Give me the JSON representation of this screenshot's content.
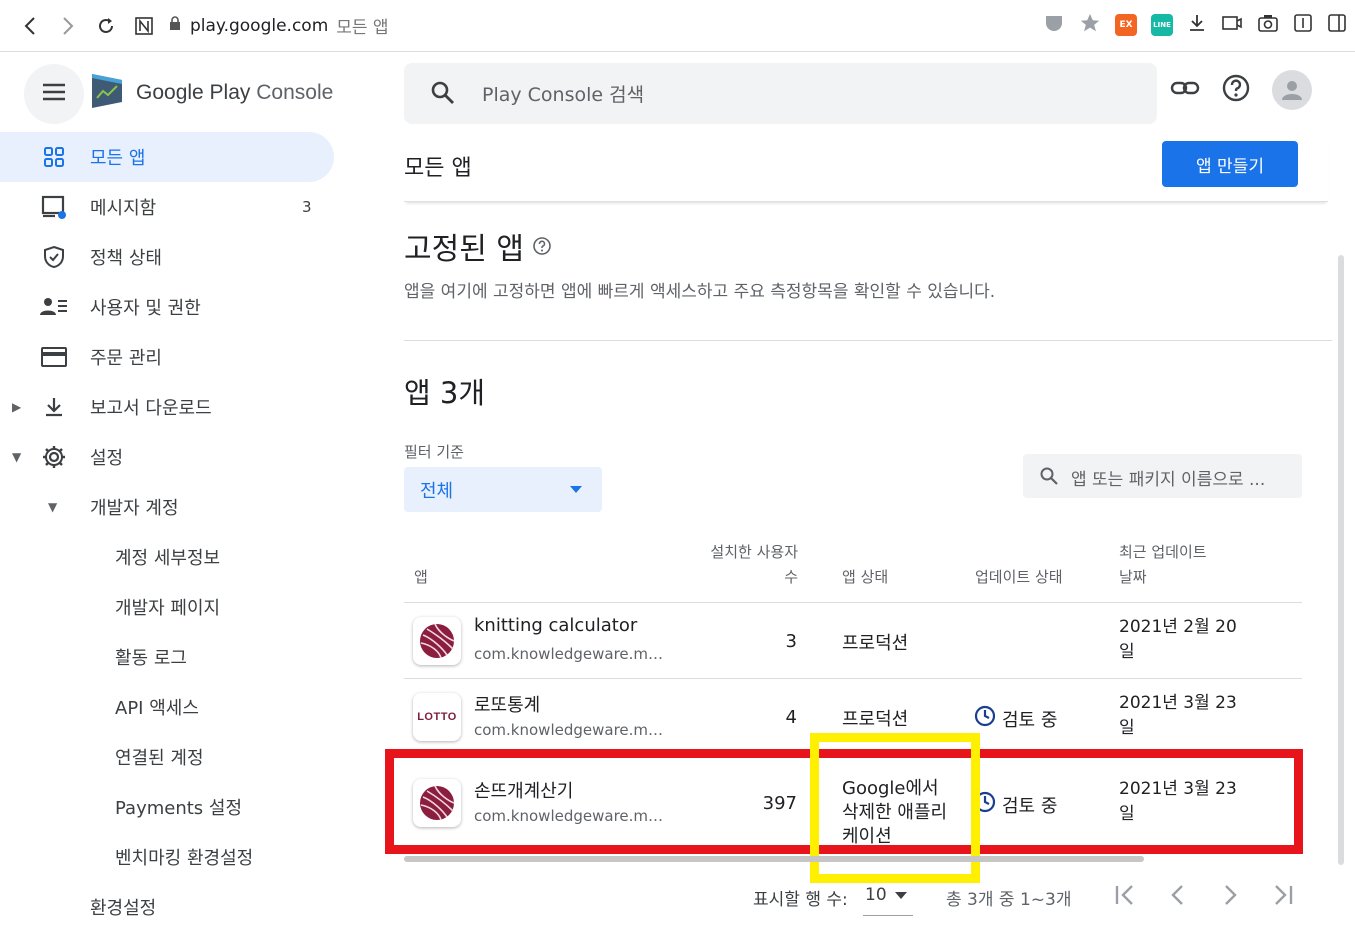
{
  "browser": {
    "host": "play.google.com",
    "path": "모든 앱",
    "ext1": "EX",
    "ext2": "LINE"
  },
  "console": {
    "logo_brand": "Google Play",
    "logo_product": "Console",
    "search_placeholder": "Play Console 검색"
  },
  "sidebar": {
    "items": [
      {
        "label": "모든 앱",
        "icon": "grid-icon"
      },
      {
        "label": "메시지함",
        "badge": "3",
        "icon": "inbox-icon"
      },
      {
        "label": "정책 상태",
        "icon": "shield-icon"
      },
      {
        "label": "사용자 및 권한",
        "icon": "users-icon"
      },
      {
        "label": "주문 관리",
        "icon": "card-icon"
      },
      {
        "label": "보고서 다운로드",
        "icon": "download-icon"
      },
      {
        "label": "설정",
        "icon": "gear-icon"
      },
      {
        "label": "개발자 계정"
      },
      {
        "label": "계정 세부정보"
      },
      {
        "label": "개발자 페이지"
      },
      {
        "label": "활동 로그"
      },
      {
        "label": "API 액세스"
      },
      {
        "label": "연결된 계정"
      },
      {
        "label": "Payments 설정"
      },
      {
        "label": "벤치마킹 환경설정"
      },
      {
        "label": "환경설정"
      }
    ]
  },
  "main": {
    "page_title": "모든 앱",
    "create_button": "앱 만들기",
    "pinned_title": "고정된 앱",
    "pinned_desc": "앱을 여기에 고정하면 앱에 빠르게 액세스하고 주요 측정항목을 확인할 수 있습니다.",
    "count_title": "앱 3개",
    "filter_label": "필터 기준",
    "filter_value": "전체",
    "app_search_placeholder": "앱 또는 패키지 이름으로 ...",
    "columns": {
      "app": "앱",
      "installs_1": "설치한 사용자",
      "installs_2": "수",
      "status": "앱 상태",
      "update_status": "업데이트 상태",
      "last_updated_1": "최근 업데이트",
      "last_updated_2": "날짜"
    },
    "rows": [
      {
        "name": "knitting calculator",
        "package": "com.knowledgeware.mod…",
        "installs": "3",
        "status": "프로덕션",
        "update_status": "",
        "date_1": "2021년 2월 20",
        "date_2": "일"
      },
      {
        "name": "로또통계",
        "package": "com.knowledgeware.mod…",
        "installs": "4",
        "status": "프로덕션",
        "update_status": "검토 중",
        "date_1": "2021년 3월 23",
        "date_2": "일",
        "icon_text": "LOTTO"
      },
      {
        "name": "손뜨개계산기",
        "package": "com.knowledgeware.mod…",
        "installs": "397",
        "status_1": "Google에서",
        "status_2": "삭제한 애플리",
        "status_3": "케이션",
        "update_status": "검토 중",
        "date_1": "2021년 3월 23",
        "date_2": "일"
      }
    ],
    "pager": {
      "rows_label": "표시할 행 수:",
      "rows_value": "10",
      "range": "총 3개 중 1~3개"
    }
  },
  "colors": {
    "accent": "#1a73e8",
    "highlight_red": "#e8141c",
    "highlight_yellow": "#ffef00"
  }
}
